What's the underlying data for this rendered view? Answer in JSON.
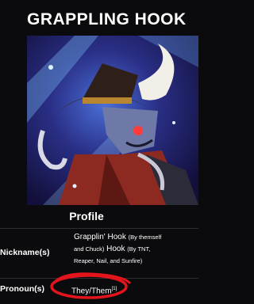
{
  "page": {
    "title": "GRAPPLING HOOK"
  },
  "infobox": {
    "image_alt": "Grappling Hook character artwork",
    "section_title": "Profile",
    "rows": [
      {
        "label": "Nickname(s)",
        "line1_name": "Grapplin' Hook",
        "line1_note": "(By themself",
        "line2_pre": "and Chuck)",
        "line2_name": "Hook",
        "line2_note": "(By TNT,",
        "line3_note": "Reaper, Nail, and Sunfire)"
      },
      {
        "label": "Pronoun(s)",
        "value": "They/Them",
        "marker": "[1]"
      }
    ]
  },
  "colors": {
    "background": "#0b0b0d",
    "text": "#ffffff",
    "annotation_red": "#e3141c"
  }
}
